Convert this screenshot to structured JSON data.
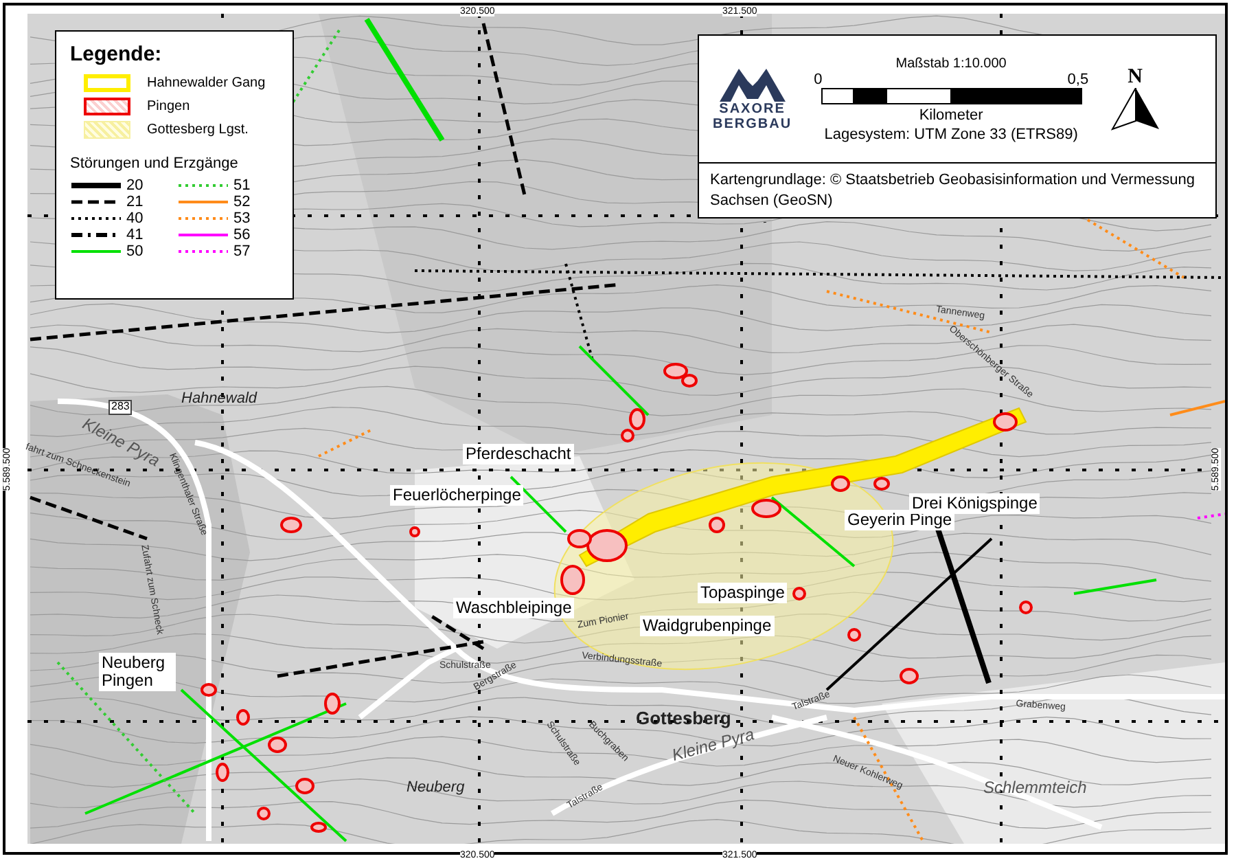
{
  "legend": {
    "title": "Legende:",
    "areas": [
      {
        "label": "Hahnewalder Gang",
        "kind": "vein"
      },
      {
        "label": "Pingen",
        "kind": "pinge"
      },
      {
        "label": "Gottesberg Lgst.",
        "kind": "zone"
      }
    ],
    "faults_title": "Störungen und Erzgänge",
    "faults": [
      {
        "label": "20",
        "kind": "thick",
        "color": "#000000"
      },
      {
        "label": "51",
        "kind": "dotted",
        "color": "#33cc33"
      },
      {
        "label": "21",
        "kind": "dashed",
        "color": "#000000"
      },
      {
        "label": "52",
        "kind": "solid",
        "color": "#ff8c1a"
      },
      {
        "label": "40",
        "kind": "dotted",
        "color": "#000000"
      },
      {
        "label": "53",
        "kind": "dotted",
        "color": "#ff8c1a"
      },
      {
        "label": "41",
        "kind": "dash-dot",
        "color": "#000000"
      },
      {
        "label": "56",
        "kind": "solid",
        "color": "#ff00ff"
      },
      {
        "label": "50",
        "kind": "solid",
        "color": "#00e000"
      },
      {
        "label": "57",
        "kind": "dotted",
        "color": "#ff00ff"
      }
    ]
  },
  "info": {
    "logo": [
      "SAXORE",
      "BERGBAU"
    ],
    "scale_title": "Maßstab 1:10.000",
    "scale_start": "0",
    "scale_end": "0,5",
    "scale_unit": "Kilometer",
    "crs": "Lagesystem: UTM Zone 33 (ETRS89)",
    "north": "N",
    "credit": "Kartengrundlage: © Staatsbetrieb Geobasisinformation und Vermessung Sachsen (GeoSN)"
  },
  "grid_labels": [
    {
      "text": "320.500",
      "kind": "top"
    },
    {
      "text": "321.500",
      "kind": "top"
    },
    {
      "text": "320.500",
      "kind": "bottom"
    },
    {
      "text": "321.500",
      "kind": "bottom"
    },
    {
      "text": "5.589.500",
      "kind": "left"
    },
    {
      "text": "5.589.500",
      "kind": "right"
    }
  ],
  "map_labels": [
    {
      "text": "Hahnewald",
      "kind": "place"
    },
    {
      "text": "283",
      "kind": "road-number"
    },
    {
      "text": "Kleine Pyra",
      "kind": "water"
    },
    {
      "text": "Pferdeschacht",
      "kind": "site"
    },
    {
      "text": "Feuerlöcherpinge",
      "kind": "site"
    },
    {
      "text": "Waschbleipinge",
      "kind": "site"
    },
    {
      "text": "Topaspinge",
      "kind": "site"
    },
    {
      "text": "Waidgrubenpinge",
      "kind": "site"
    },
    {
      "text": "Geyerin Pinge",
      "kind": "site"
    },
    {
      "text": "Drei Königspinge",
      "kind": "site"
    },
    {
      "text": "Neuberg Pingen",
      "kind": "site"
    },
    {
      "text": "Gottesberg",
      "kind": "town"
    },
    {
      "text": "Neuberg",
      "kind": "place"
    },
    {
      "text": "Schlemmteich",
      "kind": "water"
    },
    {
      "text": "Kleine Pyra",
      "kind": "water"
    },
    {
      "text": "Tannenweg",
      "kind": "street"
    },
    {
      "text": "Oberschönberger Straße",
      "kind": "street"
    },
    {
      "text": "Schulstraße",
      "kind": "street"
    },
    {
      "text": "Bergstraße",
      "kind": "street"
    },
    {
      "text": "Schulstraße",
      "kind": "street"
    },
    {
      "text": "Zum Pionier",
      "kind": "street"
    },
    {
      "text": "Verbindungsstraße",
      "kind": "street"
    },
    {
      "text": "Talstraße",
      "kind": "street"
    },
    {
      "text": "Talstraße",
      "kind": "street"
    },
    {
      "text": "Grabenweg",
      "kind": "street"
    },
    {
      "text": "Neuer Kohlerweg",
      "kind": "street"
    },
    {
      "text": "Klingenthaler Straße",
      "kind": "street"
    },
    {
      "text": "Zufahrt zum Schneck",
      "kind": "street"
    },
    {
      "text": "fahrt zum Schneckenstein",
      "kind": "street"
    },
    {
      "text": "Buchgraben",
      "kind": "street"
    }
  ]
}
